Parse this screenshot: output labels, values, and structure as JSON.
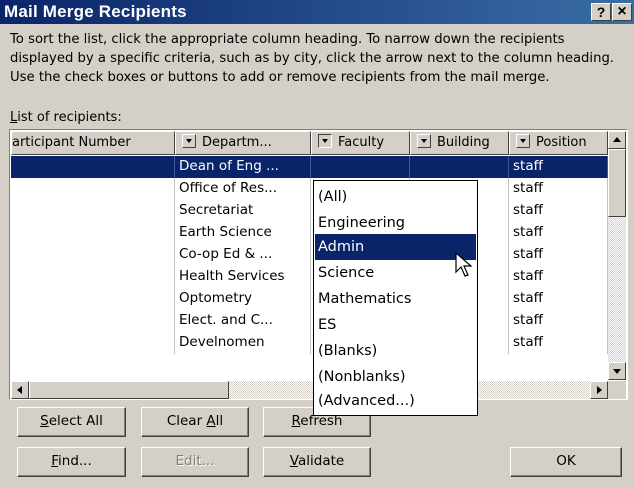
{
  "window": {
    "title": "Mail Merge Recipients",
    "help_label": "?",
    "close_label": "×"
  },
  "instructions": "To sort the list, click the appropriate column heading.  To narrow down the recipients displayed by a specific criteria, such as by city, click the arrow next to the column heading.  Use the check boxes or buttons to add or remove recipients from the mail merge.",
  "list_label": {
    "mnemonic": "L",
    "rest": "ist of recipients:"
  },
  "columns": [
    {
      "label": "articipant Number"
    },
    {
      "label": "Departm..."
    },
    {
      "label": "Faculty"
    },
    {
      "label": "Building"
    },
    {
      "label": "Position"
    }
  ],
  "rows": [
    {
      "department": "Dean of Eng ...",
      "position": "staff",
      "selected": true
    },
    {
      "department": "Office of Res...",
      "position": "staff"
    },
    {
      "department": "Secretariat",
      "position": "staff"
    },
    {
      "department": "Earth Science",
      "position": "staff"
    },
    {
      "department": "Co-op Ed & ...",
      "position": "staff"
    },
    {
      "department": "Health Services",
      "position": "staff"
    },
    {
      "department": "Optometry",
      "position": "staff"
    },
    {
      "department": "Elect. and C...",
      "position": "staff"
    },
    {
      "department": "Develnomen",
      "position": "staff"
    }
  ],
  "faculty_filter": {
    "options": [
      "(All)",
      "Engineering",
      "Admin",
      "Science",
      "Mathematics",
      "ES",
      "(Blanks)",
      "(Nonblanks)",
      "(Advanced...)"
    ],
    "highlighted": "Admin"
  },
  "buttons": {
    "select_all": {
      "mnemonic": "S",
      "rest": "elect All"
    },
    "clear_all": {
      "pre": "Clear ",
      "mnemonic": "A",
      "rest": "ll"
    },
    "refresh": {
      "mnemonic": "R",
      "rest": "efresh"
    },
    "find": {
      "mnemonic": "F",
      "rest": "ind..."
    },
    "edit": "Edit...",
    "validate": {
      "mnemonic": "V",
      "rest": "alidate"
    },
    "ok": "OK"
  },
  "colors": {
    "selection": "#0a246a",
    "face": "#d4d0c8"
  }
}
